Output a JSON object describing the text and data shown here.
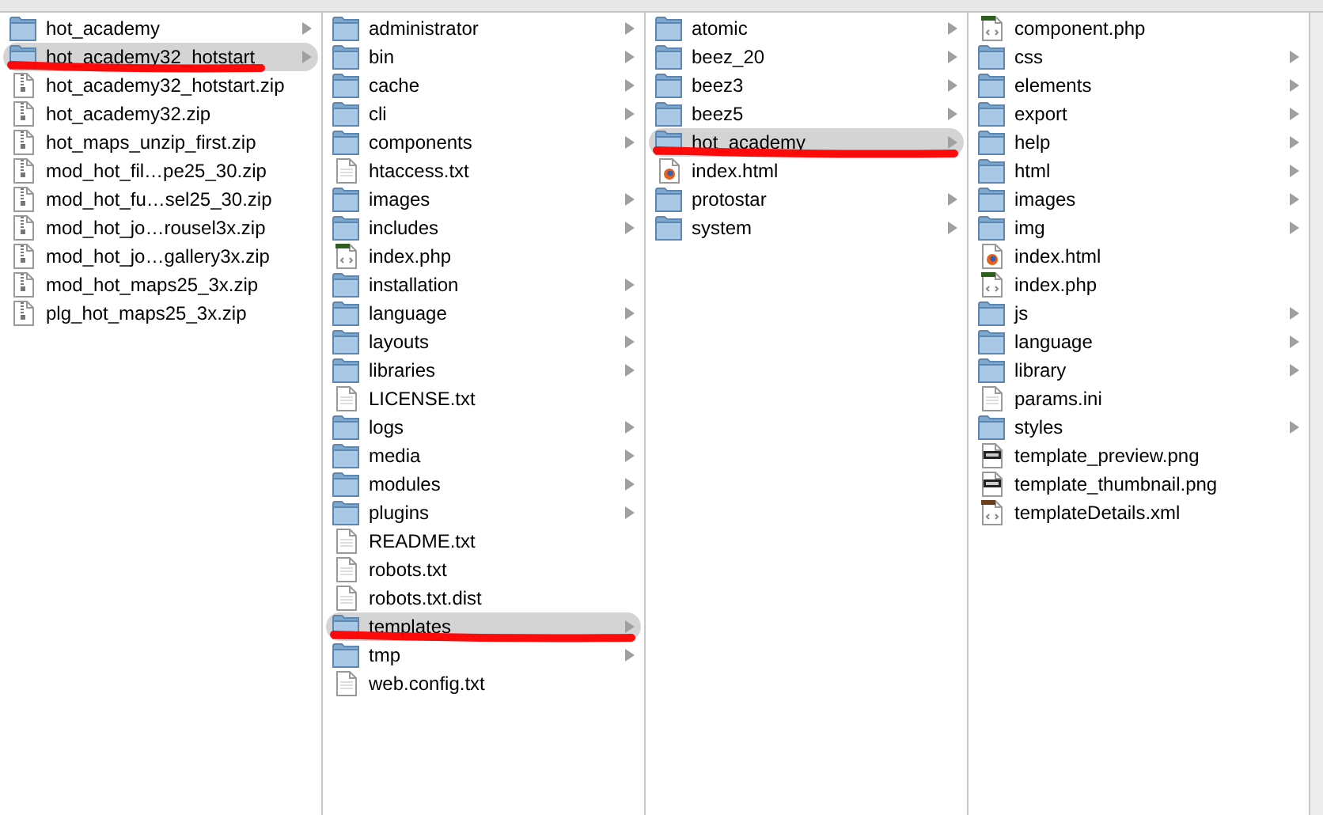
{
  "columns": [
    {
      "items": [
        {
          "name": "hot_academy",
          "kind": "folder",
          "selected": false,
          "marked": false
        },
        {
          "name": "hot_academy32_hotstart",
          "kind": "folder",
          "selected": true,
          "marked": true
        },
        {
          "name": "hot_academy32_hotstart.zip",
          "kind": "zip",
          "selected": false,
          "marked": false
        },
        {
          "name": "hot_academy32.zip",
          "kind": "zip",
          "selected": false,
          "marked": false
        },
        {
          "name": "hot_maps_unzip_first.zip",
          "kind": "zip",
          "selected": false,
          "marked": false
        },
        {
          "name": "mod_hot_fil…pe25_30.zip",
          "kind": "zip",
          "selected": false,
          "marked": false
        },
        {
          "name": "mod_hot_fu…sel25_30.zip",
          "kind": "zip",
          "selected": false,
          "marked": false
        },
        {
          "name": "mod_hot_jo…rousel3x.zip",
          "kind": "zip",
          "selected": false,
          "marked": false
        },
        {
          "name": "mod_hot_jo…gallery3x.zip",
          "kind": "zip",
          "selected": false,
          "marked": false
        },
        {
          "name": "mod_hot_maps25_3x.zip",
          "kind": "zip",
          "selected": false,
          "marked": false
        },
        {
          "name": "plg_hot_maps25_3x.zip",
          "kind": "zip",
          "selected": false,
          "marked": false
        }
      ]
    },
    {
      "items": [
        {
          "name": "administrator",
          "kind": "folder",
          "selected": false,
          "marked": false
        },
        {
          "name": "bin",
          "kind": "folder",
          "selected": false,
          "marked": false
        },
        {
          "name": "cache",
          "kind": "folder",
          "selected": false,
          "marked": false
        },
        {
          "name": "cli",
          "kind": "folder",
          "selected": false,
          "marked": false
        },
        {
          "name": "components",
          "kind": "folder",
          "selected": false,
          "marked": false
        },
        {
          "name": "htaccess.txt",
          "kind": "text",
          "selected": false,
          "marked": false
        },
        {
          "name": "images",
          "kind": "folder",
          "selected": false,
          "marked": false
        },
        {
          "name": "includes",
          "kind": "folder",
          "selected": false,
          "marked": false
        },
        {
          "name": "index.php",
          "kind": "php",
          "selected": false,
          "marked": false
        },
        {
          "name": "installation",
          "kind": "folder",
          "selected": false,
          "marked": false
        },
        {
          "name": "language",
          "kind": "folder",
          "selected": false,
          "marked": false
        },
        {
          "name": "layouts",
          "kind": "folder",
          "selected": false,
          "marked": false
        },
        {
          "name": "libraries",
          "kind": "folder",
          "selected": false,
          "marked": false
        },
        {
          "name": "LICENSE.txt",
          "kind": "text",
          "selected": false,
          "marked": false
        },
        {
          "name": "logs",
          "kind": "folder",
          "selected": false,
          "marked": false
        },
        {
          "name": "media",
          "kind": "folder",
          "selected": false,
          "marked": false
        },
        {
          "name": "modules",
          "kind": "folder",
          "selected": false,
          "marked": false
        },
        {
          "name": "plugins",
          "kind": "folder",
          "selected": false,
          "marked": false
        },
        {
          "name": "README.txt",
          "kind": "text",
          "selected": false,
          "marked": false
        },
        {
          "name": "robots.txt",
          "kind": "text",
          "selected": false,
          "marked": false
        },
        {
          "name": "robots.txt.dist",
          "kind": "text",
          "selected": false,
          "marked": false
        },
        {
          "name": "templates",
          "kind": "folder",
          "selected": true,
          "marked": true
        },
        {
          "name": "tmp",
          "kind": "folder",
          "selected": false,
          "marked": false
        },
        {
          "name": "web.config.txt",
          "kind": "text",
          "selected": false,
          "marked": false
        }
      ]
    },
    {
      "items": [
        {
          "name": "atomic",
          "kind": "folder",
          "selected": false,
          "marked": false
        },
        {
          "name": "beez_20",
          "kind": "folder",
          "selected": false,
          "marked": false
        },
        {
          "name": "beez3",
          "kind": "folder",
          "selected": false,
          "marked": false
        },
        {
          "name": "beez5",
          "kind": "folder",
          "selected": false,
          "marked": false
        },
        {
          "name": "hot_academy",
          "kind": "folder",
          "selected": true,
          "marked": true
        },
        {
          "name": "index.html",
          "kind": "html",
          "selected": false,
          "marked": false
        },
        {
          "name": "protostar",
          "kind": "folder",
          "selected": false,
          "marked": false
        },
        {
          "name": "system",
          "kind": "folder",
          "selected": false,
          "marked": false
        }
      ]
    },
    {
      "items": [
        {
          "name": "component.php",
          "kind": "php",
          "selected": false,
          "marked": false
        },
        {
          "name": "css",
          "kind": "folder",
          "selected": false,
          "marked": false
        },
        {
          "name": "elements",
          "kind": "folder",
          "selected": false,
          "marked": false
        },
        {
          "name": "export",
          "kind": "folder",
          "selected": false,
          "marked": false
        },
        {
          "name": "help",
          "kind": "folder",
          "selected": false,
          "marked": false
        },
        {
          "name": "html",
          "kind": "folder",
          "selected": false,
          "marked": false
        },
        {
          "name": "images",
          "kind": "folder",
          "selected": false,
          "marked": false
        },
        {
          "name": "img",
          "kind": "folder",
          "selected": false,
          "marked": false
        },
        {
          "name": "index.html",
          "kind": "html",
          "selected": false,
          "marked": false
        },
        {
          "name": "index.php",
          "kind": "php",
          "selected": false,
          "marked": false
        },
        {
          "name": "js",
          "kind": "folder",
          "selected": false,
          "marked": false
        },
        {
          "name": "language",
          "kind": "folder",
          "selected": false,
          "marked": false
        },
        {
          "name": "library",
          "kind": "folder",
          "selected": false,
          "marked": false
        },
        {
          "name": "params.ini",
          "kind": "text",
          "selected": false,
          "marked": false
        },
        {
          "name": "styles",
          "kind": "folder",
          "selected": false,
          "marked": false
        },
        {
          "name": "template_preview.png",
          "kind": "image",
          "selected": false,
          "marked": false
        },
        {
          "name": "template_thumbnail.png",
          "kind": "image",
          "selected": false,
          "marked": false
        },
        {
          "name": "templateDetails.xml",
          "kind": "xml",
          "selected": false,
          "marked": false
        }
      ]
    }
  ]
}
